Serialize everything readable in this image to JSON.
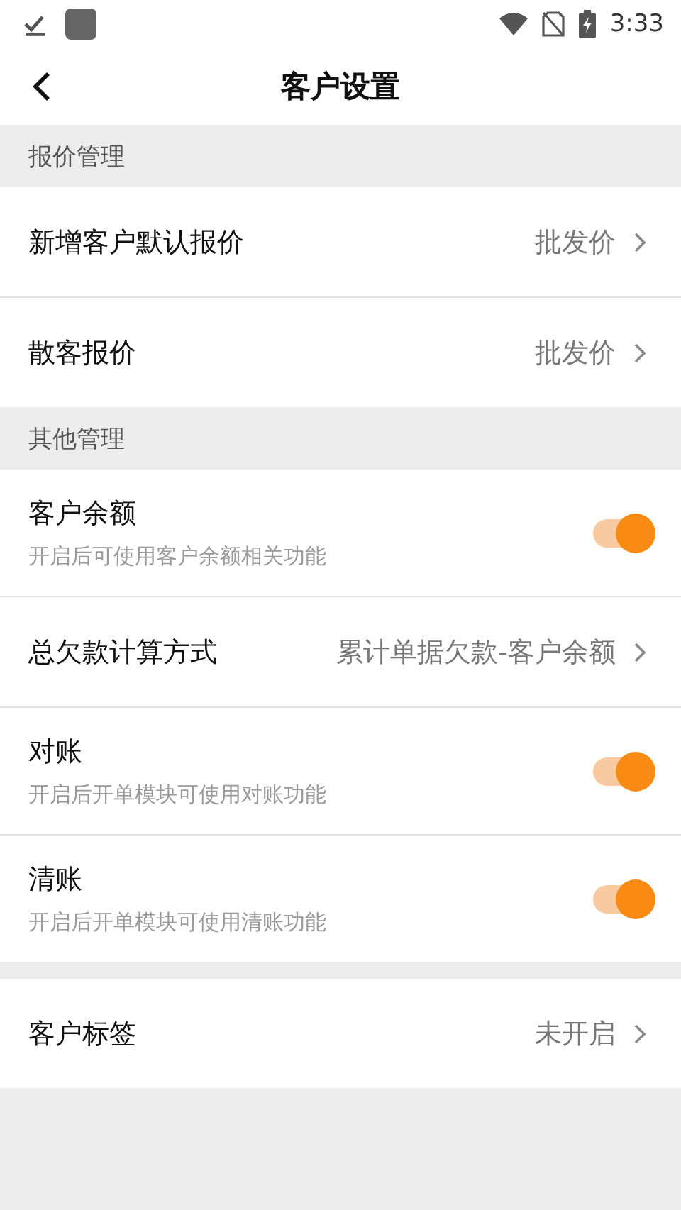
{
  "status_bar": {
    "time": "3:33"
  },
  "header": {
    "title": "客户设置"
  },
  "sections": [
    {
      "title": "报价管理",
      "rows": [
        {
          "kind": "link",
          "label": "新增客户默认报价",
          "value": "批发价"
        },
        {
          "kind": "link",
          "label": "散客报价",
          "value": "批发价"
        }
      ]
    },
    {
      "title": "其他管理",
      "rows": [
        {
          "kind": "toggle",
          "label": "客户余额",
          "subtitle": "开启后可使用客户余额相关功能",
          "on": true
        },
        {
          "kind": "link",
          "label": "总欠款计算方式",
          "value": "累计单据欠款-客户余额"
        },
        {
          "kind": "toggle",
          "label": "对账",
          "subtitle": "开启后开单模块可使用对账功能",
          "on": true
        },
        {
          "kind": "toggle",
          "label": "清账",
          "subtitle": "开启后开单模块可使用清账功能",
          "on": true
        }
      ]
    },
    {
      "rows": [
        {
          "kind": "link",
          "label": "客户标签",
          "value": "未开启"
        }
      ]
    }
  ]
}
